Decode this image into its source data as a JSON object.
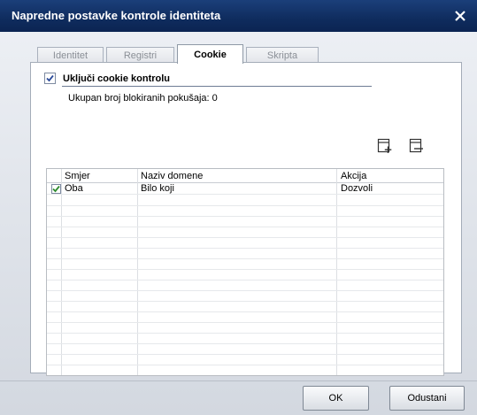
{
  "window": {
    "title": "Napredne postavke kontrole identiteta",
    "close_icon": "close-icon"
  },
  "tabs": [
    {
      "label": "Identitet",
      "active": false
    },
    {
      "label": "Registri",
      "active": false
    },
    {
      "label": "Cookie",
      "active": true
    },
    {
      "label": "Skripta",
      "active": false
    }
  ],
  "cookie": {
    "enable_label": "Uključi cookie kontrolu",
    "enabled": true,
    "blocked_text": "Ukupan broj blokiranih pokušaja: 0",
    "add_icon": "add-rule-icon",
    "edit_icon": "edit-rule-icon"
  },
  "grid": {
    "columns": [
      "Smjer",
      "Naziv domene",
      "Akcija"
    ],
    "rows": [
      {
        "checked": true,
        "direction": "Oba",
        "domain": "Bilo koji",
        "action": "Dozvoli"
      }
    ]
  },
  "buttons": {
    "ok": "OK",
    "cancel": "Odustani"
  }
}
